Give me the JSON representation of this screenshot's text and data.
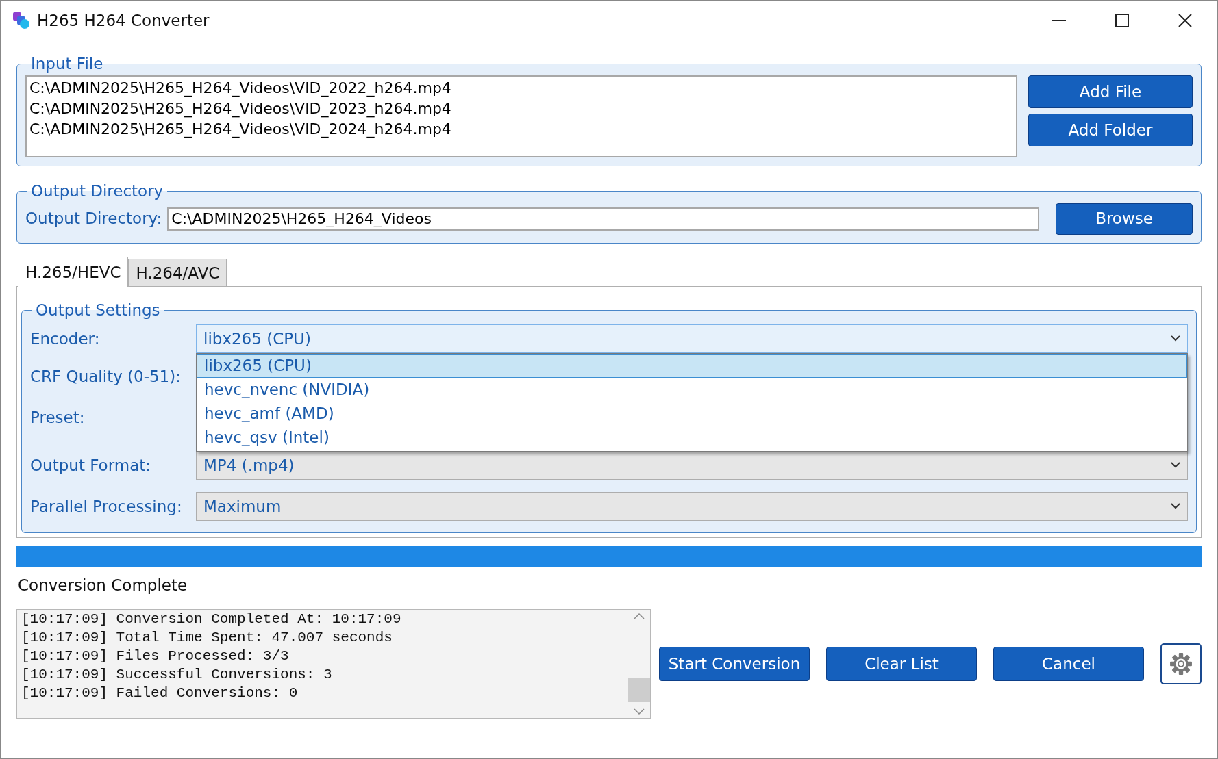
{
  "window": {
    "title": "H265 H264 Converter"
  },
  "input_file": {
    "legend": "Input File",
    "files": [
      "C:\\ADMIN2025\\H265_H264_Videos\\VID_2022_h264.mp4",
      "C:\\ADMIN2025\\H265_H264_Videos\\VID_2023_h264.mp4",
      "C:\\ADMIN2025\\H265_H264_Videos\\VID_2024_h264.mp4"
    ],
    "buttons": [
      "Add File",
      "Add Folder"
    ]
  },
  "output_directory": {
    "legend": "Output Directory",
    "label": "Output Directory:",
    "value": "C:\\ADMIN2025\\H265_H264_Videos",
    "button": "Browse"
  },
  "tabs": [
    {
      "label": "H.265/HEVC",
      "selected": true
    },
    {
      "label": "H.264/AVC",
      "selected": false
    }
  ],
  "output_settings": {
    "legend": "Output Settings",
    "fields": [
      {
        "label": "Encoder:",
        "kind": "combo",
        "value": "libx265 (CPU)",
        "expanded": true,
        "options": [
          {
            "label": "libx265 (CPU)",
            "selected": true
          },
          {
            "label": "hevc_nvenc (NVIDIA)",
            "selected": false
          },
          {
            "label": "hevc_amf (AMD)",
            "selected": false
          },
          {
            "label": "hevc_qsv (Intel)",
            "selected": false
          }
        ]
      },
      {
        "label": "CRF Quality (0-51):",
        "kind": "hidden"
      },
      {
        "label": "Preset:",
        "kind": "hidden"
      },
      {
        "label": "Output Format:",
        "kind": "combo",
        "value": "MP4 (.mp4)",
        "expanded": false
      },
      {
        "label": "Parallel Processing:",
        "kind": "combo",
        "value": "Maximum",
        "expanded": false
      }
    ]
  },
  "progress": {
    "level": 1
  },
  "status": "Conversion Complete",
  "log": [
    "[10:17:09] Conversion Completed At: 10:17:09",
    "[10:17:09] Total Time Spent: 47.007 seconds",
    "[10:17:09] Files Processed: 3/3",
    "[10:17:09] Successful Conversions: 3",
    "[10:17:09] Failed Conversions: 0"
  ],
  "actions": [
    "Start Conversion",
    "Clear List",
    "Cancel"
  ]
}
